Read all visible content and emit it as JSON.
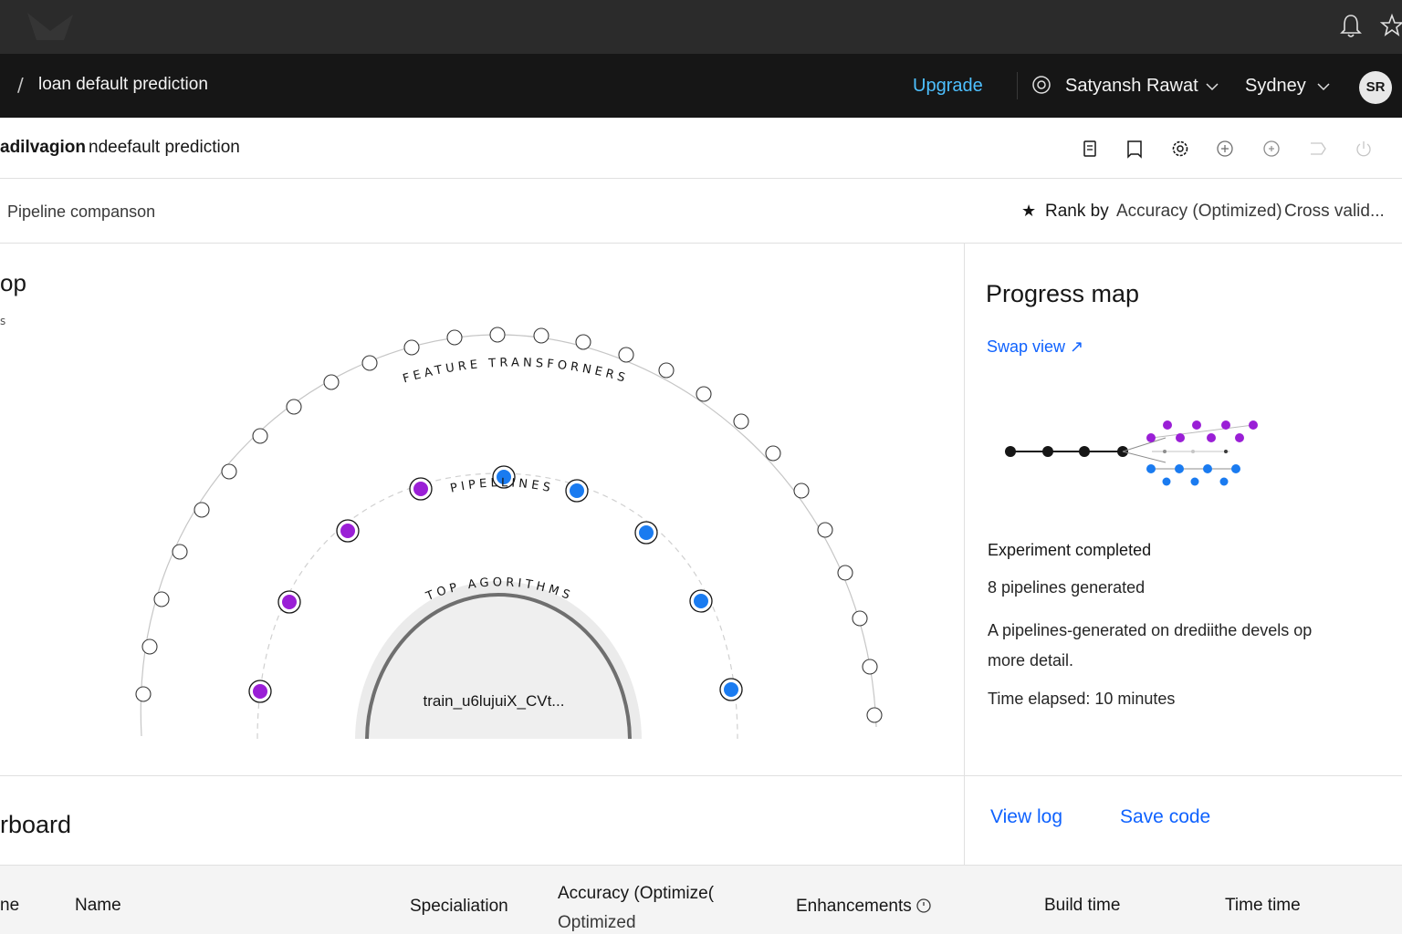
{
  "browser": {
    "icons": [
      "bell-icon",
      "star-icon"
    ]
  },
  "header": {
    "breadcrumb_separator": "/",
    "breadcrumb": "loan default prediction",
    "upgrade": "Upgrade",
    "account": "Satyansh Rawat",
    "region": "Sydney",
    "avatar_initials": "SR",
    "link_color": "#4ec0ff"
  },
  "title_row": {
    "project": "adilvagion",
    "experiment": "ndeefault prediction",
    "toolbar_icons": [
      "notebook-icon",
      "bookmark-icon",
      "settings-icon",
      "add-circle-icon",
      "add-circle-outline-icon",
      "edit-icon",
      "power-icon"
    ]
  },
  "sub_row": {
    "title": "Pipeline companson",
    "rank_by_label": "Rank by",
    "rank_by_value": "Accuracy (Optimized)",
    "cross_validation": "Cross valid..."
  },
  "relationship_map": {
    "title": "op",
    "subtitle": "s",
    "ring_labels": {
      "outer": "FEATURE TRANSFORNERS",
      "middle": "PIPELLINES",
      "inner": "TOP AGORITHMS"
    },
    "center_label": "train_u6lujuiX_CVt...",
    "colors": {
      "purple": "#9a1fd6",
      "blue": "#1a7bf0"
    }
  },
  "progress_map": {
    "title": "Progress map",
    "swap_view": "Swap view ↗",
    "status": "Experiment completed",
    "pipelines_count": "8 pipelines generated",
    "description": "A pipelines-generated on drediithe devels op more detail.",
    "time_elapsed": "Time elapsed: 10 minutes"
  },
  "leaderboard": {
    "title": "rboard",
    "view_log": "View log",
    "save_code": "Save code",
    "columns": [
      "ne",
      "Name",
      "Specialiation",
      "Accuracy (Optimize(",
      "Optimized",
      "Enhancements",
      "Build time",
      "Time time"
    ]
  }
}
